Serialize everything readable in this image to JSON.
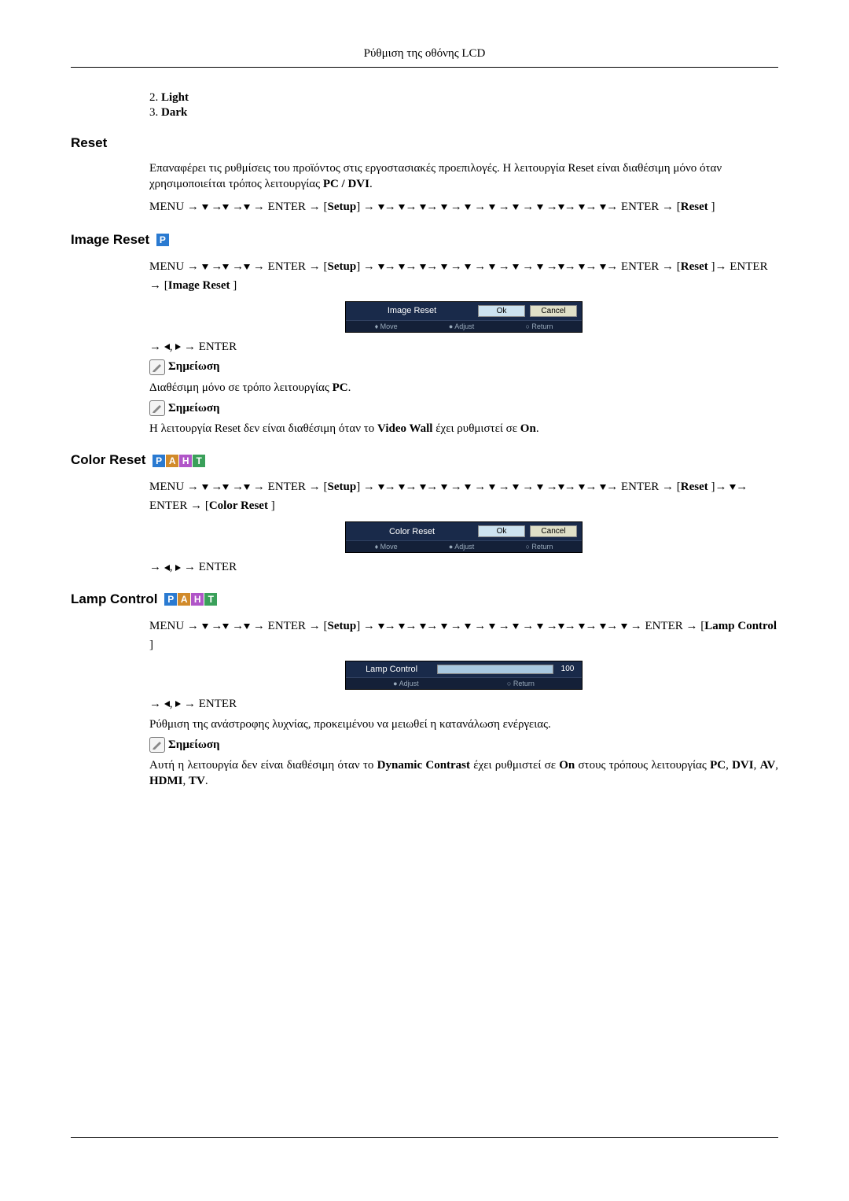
{
  "header": {
    "title": "Ρύθμιση της οθόνης LCD"
  },
  "list": {
    "item2_num": "2.",
    "item2_label": "Light",
    "item3_num": "3.",
    "item3_label": "Dark"
  },
  "reset": {
    "heading": "Reset",
    "p1_a": "Επαναφέρει τις ρυθμίσεις του προϊόντος στις εργοστασιακές προεπιλογές. Η λειτουργία Reset είναι διαθέσιμη μόνο όταν χρησιμοποιείται τρόπος λειτουργίας ",
    "p1_b": "PC / DVI",
    "p1_c": ".",
    "seq_menu": "MENU → ",
    "seq_enter": " → ENTER → [",
    "seq_setup": "Setup",
    "seq_mid": "] → ",
    "seq_end_a": " ENTER → [",
    "seq_reset": "Reset",
    "seq_end_b": " ]"
  },
  "image_reset": {
    "heading": "Image Reset",
    "seq_line2_enter": "ENTER → [",
    "seq_line2_reset": "Reset",
    "seq_line2_mid": " ]→ ENTER → [",
    "seq_line2_img": "Image Reset",
    "seq_line2_end": " ]",
    "osd_label": "Image Reset",
    "osd_ok": "Ok",
    "osd_cancel": "Cancel",
    "osd_move": "Move",
    "osd_adjust": "Adjust",
    "osd_return": "Return",
    "after_a": "→ ",
    "after_b": " → ENTER",
    "note_label": "Σημείωση",
    "note1_a": "Διαθέσιμη μόνο σε τρόπο λειτουργίας ",
    "note1_b": "PC",
    "note1_c": ".",
    "note2_a": "Η λειτουργία Reset δεν είναι διαθέσιμη όταν το ",
    "note2_b": "Video Wall",
    "note2_c": " έχει ρυθμιστεί σε ",
    "note2_d": "On",
    "note2_e": "."
  },
  "color_reset": {
    "heading": "Color Reset",
    "seq_line2_enter": "ENTER → [",
    "seq_line2_reset": "Reset",
    "seq_line2_mid": " ]→ ",
    "seq_line2_enter2": "→ ENTER → [",
    "seq_line2_color": "Color Reset",
    "seq_line2_end": " ]",
    "osd_label": "Color Reset",
    "osd_ok": "Ok",
    "osd_cancel": "Cancel",
    "osd_move": "Move",
    "osd_adjust": "Adjust",
    "osd_return": "Return",
    "after_a": "→ ",
    "after_b": " → ENTER"
  },
  "lamp": {
    "heading": "Lamp Control",
    "seq_line2_a": " → ENTER → [",
    "seq_line2_b": "Lamp Control",
    "seq_line2_c": " ]",
    "osd_label": "Lamp Control",
    "osd_value": "100",
    "osd_adjust": "Adjust",
    "osd_return": "Return",
    "after_a": "→ ",
    "after_b": " → ENTER",
    "p1": "Ρύθμιση της ανάστροφης λυχνίας, προκειμένου να μειωθεί η κατανάλωση ενέργειας.",
    "note_label": "Σημείωση",
    "note_a": "Αυτή η λειτουργία δεν είναι διαθέσιμη όταν το ",
    "note_b": "Dynamic Contrast",
    "note_c": " έχει ρυθμιστεί σε ",
    "note_d": "On",
    "note_e": " στους τρόπους λειτουργίας ",
    "note_f": "PC",
    "note_g": ", ",
    "note_h": "DVI",
    "note_i": ", ",
    "note_j": "AV",
    "note_k": ", ",
    "note_l": "HDMI",
    "note_m": ", ",
    "note_n": "TV",
    "note_o": "."
  }
}
